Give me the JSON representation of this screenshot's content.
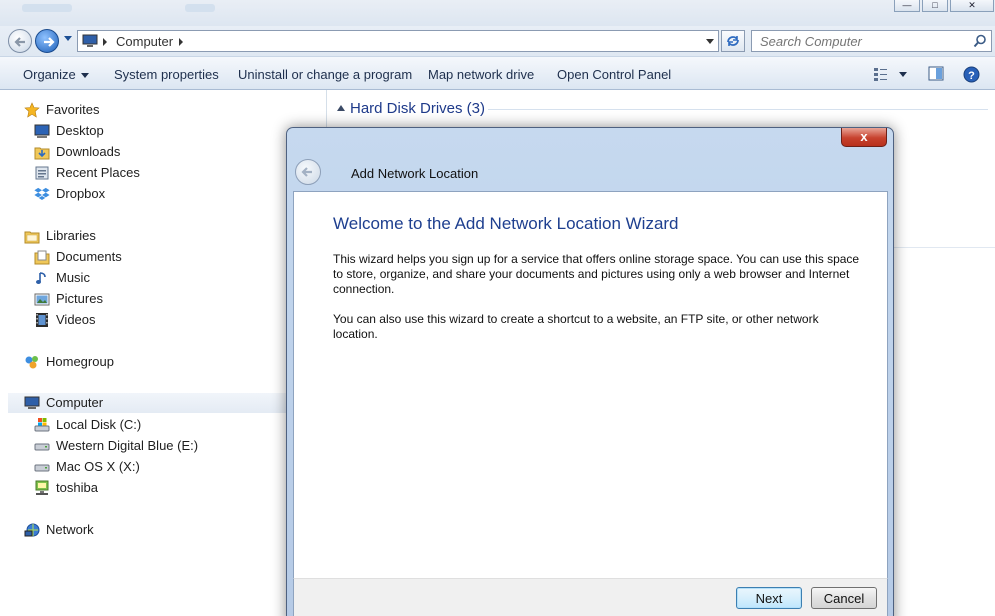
{
  "address_bar": {
    "breadcrumb": "Computer",
    "search_placeholder": "Search Computer"
  },
  "command_bar": {
    "organize": "Organize",
    "system_properties": "System properties",
    "uninstall": "Uninstall or change a program",
    "map_drive": "Map network drive",
    "control_panel": "Open Control Panel"
  },
  "sidebar": {
    "favorites": {
      "label": "Favorites",
      "items": [
        "Desktop",
        "Downloads",
        "Recent Places",
        "Dropbox"
      ]
    },
    "libraries": {
      "label": "Libraries",
      "items": [
        "Documents",
        "Music",
        "Pictures",
        "Videos"
      ]
    },
    "homegroup": "Homegroup",
    "computer": {
      "label": "Computer",
      "items": [
        "Local Disk (C:)",
        "Western Digital Blue (E:)",
        "Mac OS X (X:)",
        "toshiba"
      ]
    },
    "network": "Network"
  },
  "content": {
    "group_title": "Hard Disk Drives (3)"
  },
  "dialog": {
    "close": "x",
    "title": "Add Network Location",
    "heading": "Welcome to the Add Network Location Wizard",
    "paragraph1": "This wizard helps you sign up for a service that offers online storage space.  You can use this space to store, organize, and share your documents and pictures using only a web browser and Internet connection.",
    "paragraph2": "You can also use this wizard to create a shortcut to a website, an FTP site, or other network location.",
    "next": "Next",
    "cancel": "Cancel"
  },
  "colors": {
    "link_blue": "#1e3a8a",
    "dialog_frame": "#b5cae6",
    "close_red": "#c7422e"
  }
}
